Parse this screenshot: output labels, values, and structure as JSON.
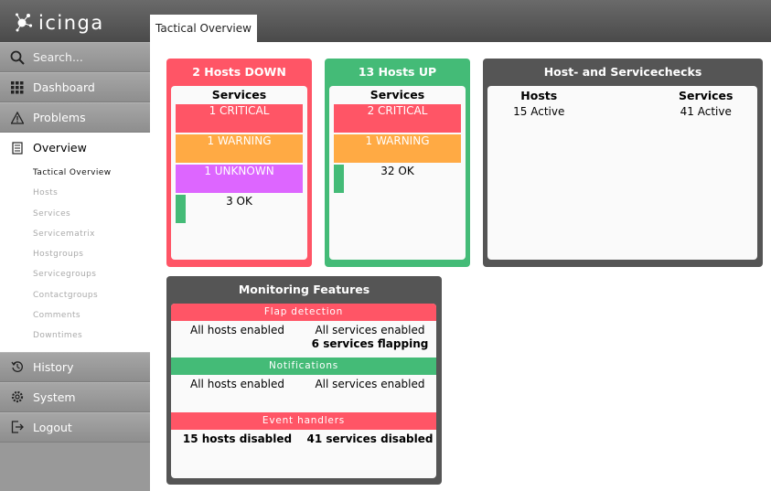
{
  "header": {
    "logo": "icinga",
    "tab": "Tactical Overview"
  },
  "sidebar": {
    "search_placeholder": "Search...",
    "items": [
      {
        "label": "Dashboard"
      },
      {
        "label": "Problems"
      },
      {
        "label": "Overview"
      }
    ],
    "submenu": [
      "Tactical Overview",
      "Hosts",
      "Services",
      "Servicematrix",
      "Hostgroups",
      "Servicegroups",
      "Contactgroups",
      "Comments",
      "Downtimes"
    ],
    "bottom": [
      {
        "label": "History"
      },
      {
        "label": "System"
      },
      {
        "label": "Logout"
      }
    ]
  },
  "hosts_down": {
    "title": "2 Hosts DOWN",
    "services_title": "Services",
    "critical": "1 CRITICAL",
    "warning": "1 WARNING",
    "unknown": "1 UNKNOWN",
    "ok": "3 OK"
  },
  "hosts_up": {
    "title": "13 Hosts UP",
    "services_title": "Services",
    "critical": "2 CRITICAL",
    "warning": "1 WARNING",
    "ok": "32 OK"
  },
  "checks": {
    "title": "Host- and Servicechecks",
    "hosts_label": "Hosts",
    "services_label": "Services",
    "hosts_value": "15 Active",
    "services_value": "41 Active"
  },
  "features": {
    "title": "Monitoring Features",
    "flap": {
      "head": "Flap detection",
      "hosts": "All hosts enabled",
      "services": "All services enabled",
      "services_extra": "6 services flapping"
    },
    "notifications": {
      "head": "Notifications",
      "hosts": "All hosts enabled",
      "services": "All services enabled"
    },
    "event_handlers": {
      "head": "Event handlers",
      "hosts": "15 hosts disabled",
      "services": "41 services disabled"
    }
  },
  "colors": {
    "down": "#ff5566",
    "up": "#44bb77",
    "dark": "#555555",
    "critical": "#ff5566",
    "warning": "#ffaa44",
    "unknown": "#dd66ff",
    "ok": "#44bb77"
  }
}
